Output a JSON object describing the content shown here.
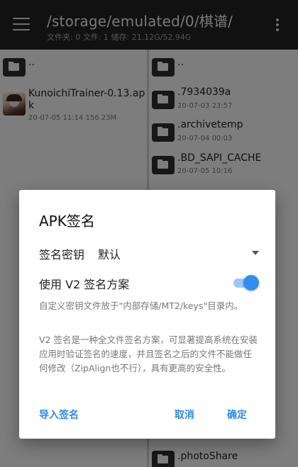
{
  "toolbar": {
    "path": "/storage/emulated/0/棋谱/",
    "stats": "文件夹: 0  文件: 1  储存: 21.12G/52.94G",
    "menu_icon": "hamburger-menu-icon",
    "more_icon": "more-vert-icon"
  },
  "left_pane": {
    "items": [
      {
        "type": "folder",
        "name": "..",
        "meta": ""
      },
      {
        "type": "apk",
        "name_line1": "KunoichiTrainer-0.13.ap",
        "name_line2": "k",
        "meta": "20-07-05 11:14  156.23M"
      }
    ]
  },
  "right_pane": {
    "items": [
      {
        "type": "folder",
        "name": "..",
        "meta": ""
      },
      {
        "type": "folder",
        "name": ".7934039a",
        "meta": "20-07-03 23:57"
      },
      {
        "type": "folder",
        "name": ".archivetemp",
        "meta": "20-07-04 00:03"
      },
      {
        "type": "folder",
        "name": ".BD_SAPI_CACHE",
        "meta": "20-07-05 10:16"
      },
      {
        "type": "folder",
        "name": ".photoShare",
        "meta": ""
      }
    ]
  },
  "dialog": {
    "title": "APK签名",
    "key_label": "签名密钥",
    "key_value": "默认",
    "v2_label": "使用 V2 签名方案",
    "v2_enabled": true,
    "note1": "自定义密钥文件放于\"内部存储/MT2/keys\"目录内。",
    "note2": "V2 签名是一种全文件签名方案，可显著提高系统在安装应用时验证签名的速度，并且签名之后的文件不能做任何修改（ZipAlign也不行），具有更高的安全性。",
    "import_button": "导入签名",
    "cancel_button": "取消",
    "ok_button": "确定"
  },
  "colors": {
    "toolbar_bg": "#232323",
    "accent": "#2f8ff0",
    "button_text": "#2b8be8"
  }
}
